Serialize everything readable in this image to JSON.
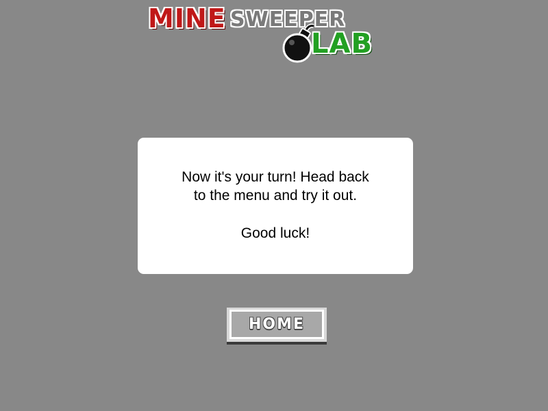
{
  "logo": {
    "word_mine": "MINE",
    "word_sweeper": "SWEEPER",
    "word_lab": "LAB",
    "icon": "bomb-icon",
    "colors": {
      "mine": "#c01818",
      "sweeper": "#7a7a7a",
      "lab": "#22a022"
    }
  },
  "message": {
    "line1": "Now it's your turn! Head back",
    "line2": "to the menu and try it out.",
    "line3": "Good luck!"
  },
  "home_button": {
    "label": "HOME"
  },
  "colors": {
    "background": "#888888",
    "card": "#ffffff",
    "button_face": "#a8a8a8"
  }
}
